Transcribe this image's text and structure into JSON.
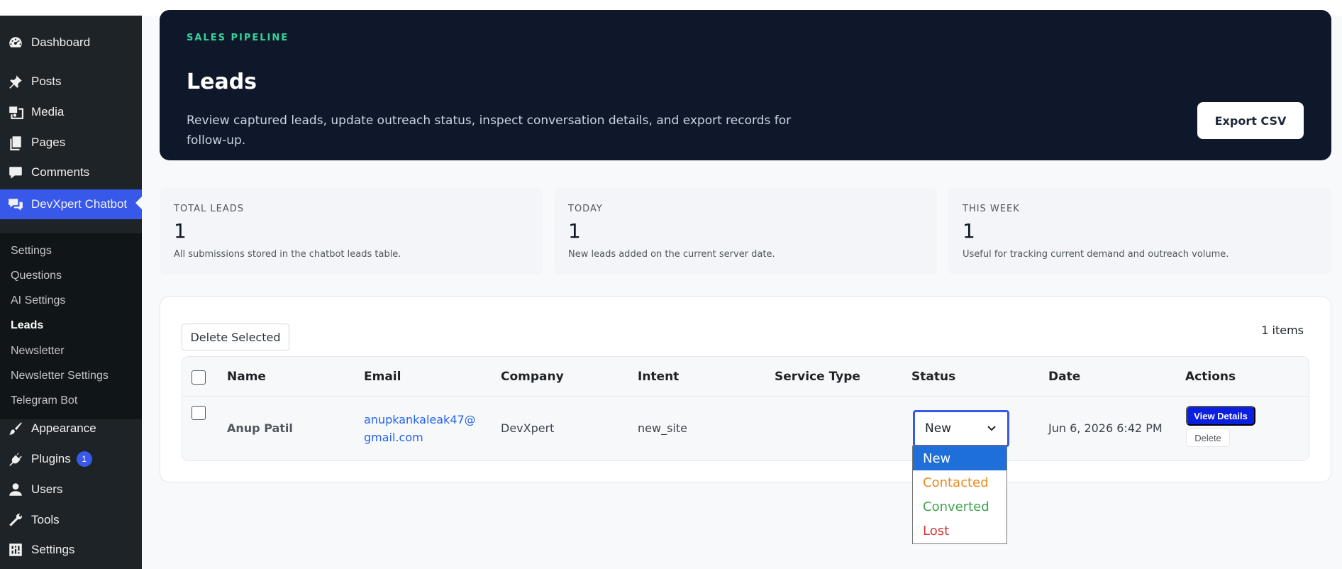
{
  "sidebar": {
    "items": [
      {
        "label": "Dashboard",
        "icon": "dashboard-icon"
      },
      {
        "label": "Posts",
        "icon": "pin-icon"
      },
      {
        "label": "Media",
        "icon": "media-icon"
      },
      {
        "label": "Pages",
        "icon": "pages-icon"
      },
      {
        "label": "Comments",
        "icon": "comments-icon"
      },
      {
        "label": "DevXpert Chatbot",
        "icon": "chat-icon"
      },
      {
        "label": "Appearance",
        "icon": "brush-icon"
      },
      {
        "label": "Plugins",
        "icon": "plug-icon",
        "badge": "1"
      },
      {
        "label": "Users",
        "icon": "user-icon"
      },
      {
        "label": "Tools",
        "icon": "wrench-icon"
      },
      {
        "label": "Settings",
        "icon": "sliders-icon"
      }
    ],
    "submenu": [
      "Settings",
      "Questions",
      "AI Settings",
      "Leads",
      "Newsletter",
      "Newsletter Settings",
      "Telegram Bot"
    ],
    "current_sub": "Leads"
  },
  "hero": {
    "eyebrow": "SALES PIPELINE",
    "title": "Leads",
    "description": "Review captured leads, update outreach status, inspect conversation details, and export records for follow-up.",
    "export_label": "Export CSV"
  },
  "stats": [
    {
      "label": "TOTAL LEADS",
      "value": "1",
      "note": "All submissions stored in the chatbot leads table."
    },
    {
      "label": "TODAY",
      "value": "1",
      "note": "New leads added on the current server date."
    },
    {
      "label": "THIS WEEK",
      "value": "1",
      "note": "Useful for tracking current demand and outreach volume."
    }
  ],
  "table": {
    "delete_selected_label": "Delete Selected",
    "items_count": "1 items",
    "columns": [
      "Name",
      "Email",
      "Company",
      "Intent",
      "Service Type",
      "Status",
      "Date",
      "Actions"
    ],
    "rows": [
      {
        "name": "Anup Patil",
        "email_line1": "anupkankaleak47@",
        "email_line2": "gmail.com",
        "company": "DevXpert",
        "intent": "new_site",
        "service_type": "",
        "status": "New",
        "date": "Jun 6, 2026 6:42 PM",
        "view_label": "View Details",
        "delete_label": "Delete"
      }
    ]
  },
  "status_options": [
    {
      "label": "New",
      "color": "#ffffff"
    },
    {
      "label": "Contacted",
      "color": "#e8891c"
    },
    {
      "label": "Converted",
      "color": "#3fa34d"
    },
    {
      "label": "Lost",
      "color": "#d63638"
    }
  ],
  "colors": {
    "accent": "#3858e9",
    "hero_bg": "#0f172a",
    "eyebrow": "#34d399",
    "view_button": "#0a1fe0"
  }
}
